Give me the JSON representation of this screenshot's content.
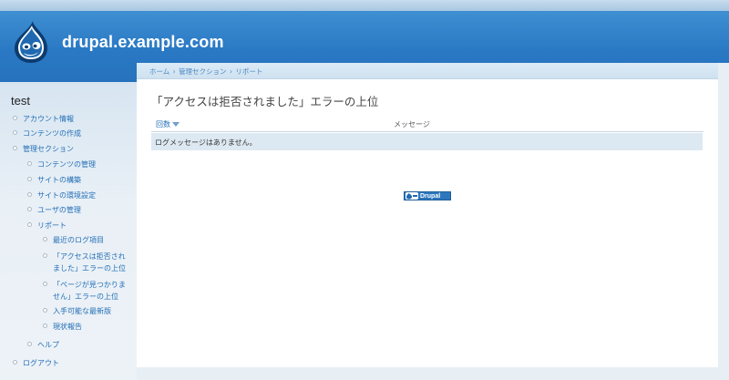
{
  "site": {
    "name": "drupal.example.com"
  },
  "sidebar": {
    "block_title": "test",
    "items": [
      {
        "label": "アカウント情報"
      },
      {
        "label": "コンテンツの作成"
      },
      {
        "label": "管理セクション"
      },
      {
        "label": "コンテンツの管理"
      },
      {
        "label": "サイトの構築"
      },
      {
        "label": "サイトの環境設定"
      },
      {
        "label": "ユーザの管理"
      },
      {
        "label": "リポート"
      },
      {
        "label": "最近のログ項目"
      },
      {
        "label": "「アクセスは拒否されました」エラーの上位"
      },
      {
        "label": "「ページが見つかりません」エラーの上位"
      },
      {
        "label": "入手可能な最新版"
      },
      {
        "label": "現状報告"
      },
      {
        "label": "ヘルプ"
      },
      {
        "label": "ログアウト"
      }
    ]
  },
  "breadcrumb": {
    "items": [
      "ホーム",
      "管理セクション",
      "リポート"
    ],
    "separator": "›"
  },
  "page": {
    "title": "「アクセスは拒否されました」エラーの上位"
  },
  "table": {
    "headers": {
      "count": "回数",
      "message": "メッセージ"
    },
    "empty_text": "ログメッセージはありません。"
  },
  "footer": {
    "powered_by": "Drupal"
  },
  "colors": {
    "header_blue": "#2a79c4",
    "link": "#236fb7",
    "row_bg": "#dde9f2"
  }
}
